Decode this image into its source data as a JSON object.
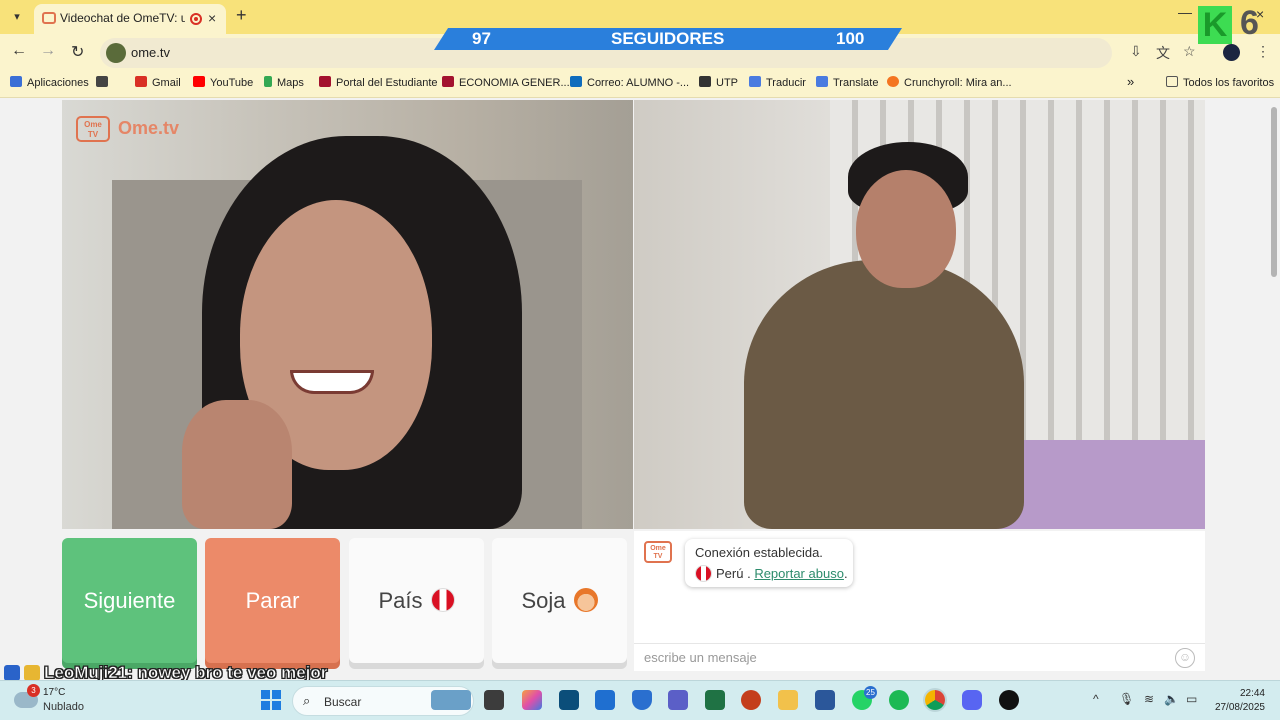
{
  "browser": {
    "tab_title": "Videochat de OmeTV: una a",
    "url": "ome.tv",
    "new_tab_symbol": "+",
    "close_symbol": "×",
    "minimize_symbol": "—",
    "bookmarks": [
      {
        "label": "Aplicaciones",
        "icon": "apps-grid-icon",
        "color": "#3b6fd6"
      },
      {
        "label": "Gmail",
        "icon": "gmail-icon",
        "color": "#d93025"
      },
      {
        "label": "YouTube",
        "icon": "youtube-icon",
        "color": "#ff0000"
      },
      {
        "label": "Maps",
        "icon": "maps-pin-icon",
        "color": "#34a853"
      },
      {
        "label": "Portal del Estudiante",
        "icon": "portal-icon",
        "color": "#a3122e"
      },
      {
        "label": "ECONOMIA GENER...",
        "icon": "portal-icon",
        "color": "#a3122e"
      },
      {
        "label": "Correo: ALUMNO -...",
        "icon": "outlook-icon",
        "color": "#0f6cbd"
      },
      {
        "label": "UTP",
        "icon": "utp-icon",
        "color": "#333333"
      },
      {
        "label": "Traducir",
        "icon": "translate-icon",
        "color": "#4a7be0"
      },
      {
        "label": "Translate",
        "icon": "translate-icon",
        "color": "#4a7be0"
      },
      {
        "label": "Crunchyroll: Mira an...",
        "icon": "crunchyroll-icon",
        "color": "#f47521"
      }
    ],
    "bookmarks_more": "»",
    "all_bookmarks": "Todos los favoritos"
  },
  "stream_overlay": {
    "followers_current": "97",
    "followers_label": "SEGUIDORES",
    "followers_goal": "100",
    "badge_number": "6",
    "comment_user": "LeoMuji21",
    "comment_text": ": nowey bro te veo mejor"
  },
  "ometv": {
    "logo_small": "Ome\nTV",
    "logo_text": "Ome.tv",
    "buttons": {
      "next": "Siguiente",
      "stop": "Parar",
      "country": "País",
      "gender": "Soja"
    },
    "chat": {
      "status": "Conexión establecida.",
      "country": "Perú",
      "separator": " . ",
      "report_link": "Reportar abuso",
      "period": ".",
      "input_placeholder": "escribe un mensaje"
    }
  },
  "taskbar": {
    "weather_temp": "17°C",
    "weather_desc": "Nublado",
    "weather_badge": "3",
    "search_label": "Buscar",
    "whatsapp_badge": "25",
    "time": "22:44",
    "date": "27/08/2025"
  },
  "colors": {
    "tabstrip": "#f8e27a",
    "next_button": "#5ec27c",
    "stop_button": "#ec8a69",
    "followers_bar": "#2a7fdc",
    "taskbar": "#d3ecef"
  }
}
